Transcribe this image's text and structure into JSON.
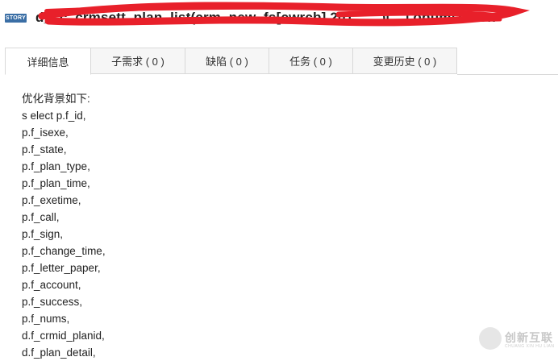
{
  "header": {
    "badge": "STORY",
    "title": "d_cc_crmsett_plan_list(crm_new_fs[cwrcb] 201……)[…] optimization"
  },
  "tabs": [
    {
      "label": "详细信息"
    },
    {
      "label": "子需求 ( 0 )"
    },
    {
      "label": "缺陷 ( 0 )"
    },
    {
      "label": "任务 ( 0 )"
    },
    {
      "label": "变更历史 ( 0 )"
    }
  ],
  "content": {
    "lines": [
      "优化背景如下:",
      "s elect p.f_id,",
      "p.f_isexe,",
      "p.f_state,",
      "p.f_plan_type,",
      "p.f_plan_time,",
      "p.f_exetime,",
      "p.f_call,",
      "p.f_sign,",
      "p.f_change_time,",
      "p.f_letter_paper,",
      "p.f_account,",
      "p.f_success,",
      "p.f_nums,",
      "d.f_crmid_planid,",
      "d.f_plan_detail,"
    ]
  },
  "watermark": {
    "text": "创新互联",
    "subtext": "CHUANG XIN HU LIAN"
  },
  "colors": {
    "badge": "#3a6ea5",
    "redaction": "#e8202a",
    "tab_border": "#d8d8d8"
  }
}
